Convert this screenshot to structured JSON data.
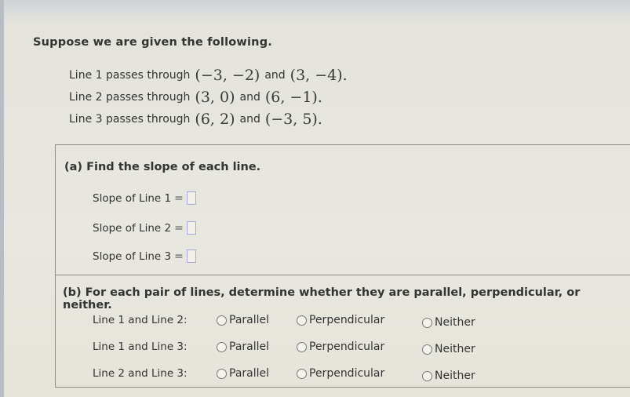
{
  "intro": "Suppose we are given the following.",
  "lines": [
    {
      "label": "Line 1 passes through",
      "p1": "(−3, −2)",
      "and": "and",
      "p2": "(3, −4)."
    },
    {
      "label": "Line 2 passes through",
      "p1": "(3, 0)",
      "and": "and",
      "p2": "(6, −1)."
    },
    {
      "label": "Line 3 passes through",
      "p1": "(6, 2)",
      "and": "and",
      "p2": "(−3, 5)."
    }
  ],
  "part_a": {
    "title": "(a)  Find the slope of each line.",
    "rows": [
      {
        "label": "Slope of Line 1",
        "eq": "=",
        "value": ""
      },
      {
        "label": "Slope of Line 2",
        "eq": "=",
        "value": ""
      },
      {
        "label": "Slope of Line 3",
        "eq": "=",
        "value": ""
      }
    ]
  },
  "part_b": {
    "title": "(b)  For each pair of lines, determine whether they are parallel, perpendicular, or neither.",
    "rows": [
      {
        "label": "Line 1 and Line 2:",
        "options": [
          "Parallel",
          "Perpendicular",
          "Neither"
        ],
        "selected": null
      },
      {
        "label": "Line 1 and Line 3:",
        "options": [
          "Parallel",
          "Perpendicular",
          "Neither"
        ],
        "selected": null
      },
      {
        "label": "Line 2 and Line 3:",
        "options": [
          "Parallel",
          "Perpendicular",
          "Neither"
        ],
        "selected": null
      }
    ]
  }
}
